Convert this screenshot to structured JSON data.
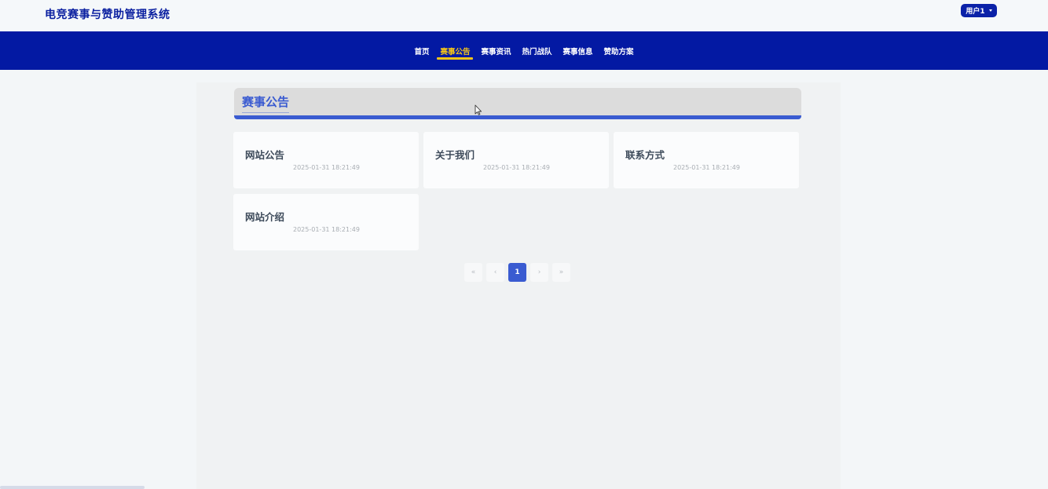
{
  "header": {
    "site_title": "电竞赛事与赞助管理系统",
    "user_label": "用户1"
  },
  "nav": {
    "items": [
      {
        "label": "首页"
      },
      {
        "label": "赛事公告"
      },
      {
        "label": "赛事资讯"
      },
      {
        "label": "热门战队"
      },
      {
        "label": "赛事信息"
      },
      {
        "label": "赞助方案"
      }
    ],
    "active_index": 1
  },
  "section": {
    "title": "赛事公告"
  },
  "cards": [
    {
      "title": "网站公告",
      "date": "2025-01-31 18:21:49"
    },
    {
      "title": "关于我们",
      "date": "2025-01-31 18:21:49"
    },
    {
      "title": "联系方式",
      "date": "2025-01-31 18:21:49"
    },
    {
      "title": "网站介绍",
      "date": "2025-01-31 18:21:49"
    }
  ],
  "pagination": {
    "first": "«",
    "prev": "‹",
    "current": "1",
    "next": "›",
    "last": "»"
  },
  "colors": {
    "brand": "#0319a3",
    "accent": "#3a5bd1",
    "active_nav": "#f5c518"
  }
}
